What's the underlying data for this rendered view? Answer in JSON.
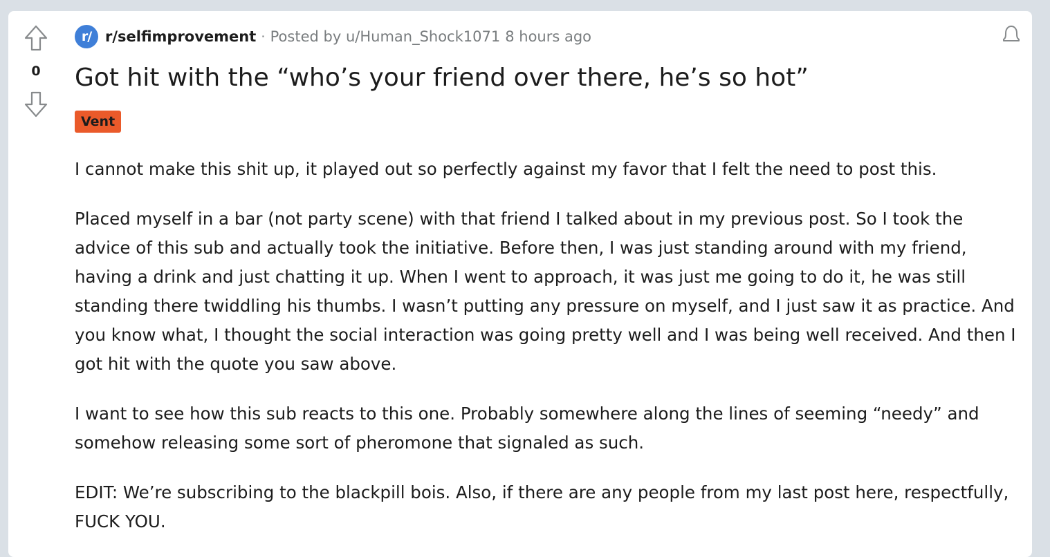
{
  "post": {
    "score": "0",
    "subreddit": {
      "icon_text": "r/",
      "name": "r/selfimprovement",
      "icon_color": "#3f7fd8"
    },
    "separator": "·",
    "posted_by_label": "Posted by",
    "author": "u/Human_Shock1071",
    "time": "8 hours ago",
    "title": "Got hit with the “who’s your friend over there, he’s so hot”",
    "flair": {
      "label": "Vent",
      "color": "#ea5a2a"
    },
    "paragraphs": [
      "I cannot make this shit up, it played out so perfectly against my favor that I felt the need to post this.",
      "Placed myself in a bar (not party scene) with that friend I talked about in my previous post. So I took the advice of this sub and actually took the initiative. Before then, I was just standing around with my friend, having a drink and just chatting it up. When I went to approach, it was just me going to do it, he was still standing there twiddling his thumbs. I wasn’t putting any pressure on myself, and I just saw it as practice. And you know what, I thought the social interaction was going pretty well and I was being well received. And then I got hit with the quote you saw above.",
      "I want to see how this sub reacts to this one. Probably somewhere along the lines of seeming “needy” and somehow releasing some sort of pheromone that signaled as such.",
      "EDIT: We’re subscribing to the blackpill bois. Also, if there are any people from my last post here, respectfully, FUCK YOU."
    ],
    "icons": {
      "upvote": "upvote-arrow-icon",
      "downvote": "downvote-arrow-icon",
      "notify": "bell-icon"
    }
  }
}
